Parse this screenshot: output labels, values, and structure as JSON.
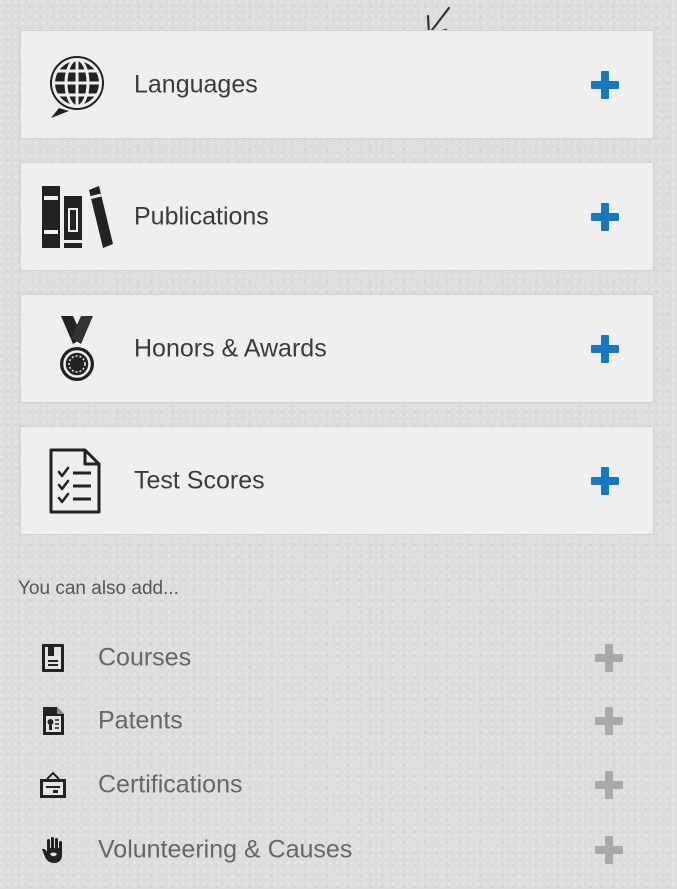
{
  "sections": [
    {
      "label": "Languages",
      "icon": "globe-speech-icon"
    },
    {
      "label": "Publications",
      "icon": "books-icon"
    },
    {
      "label": "Honors & Awards",
      "icon": "medal-icon"
    },
    {
      "label": "Test Scores",
      "icon": "checklist-icon"
    }
  ],
  "also": {
    "heading": "You can also add...",
    "items": [
      {
        "label": "Courses",
        "icon": "course-book-icon"
      },
      {
        "label": "Patents",
        "icon": "patent-document-icon"
      },
      {
        "label": "Certifications",
        "icon": "certificate-icon"
      },
      {
        "label": "Volunteering & Causes",
        "icon": "hand-icon"
      }
    ]
  },
  "colors": {
    "add_accent": "#1679c2",
    "add_muted": "#a9a9a9",
    "card_bg": "#efefef",
    "page_bg": "#dddddd"
  }
}
